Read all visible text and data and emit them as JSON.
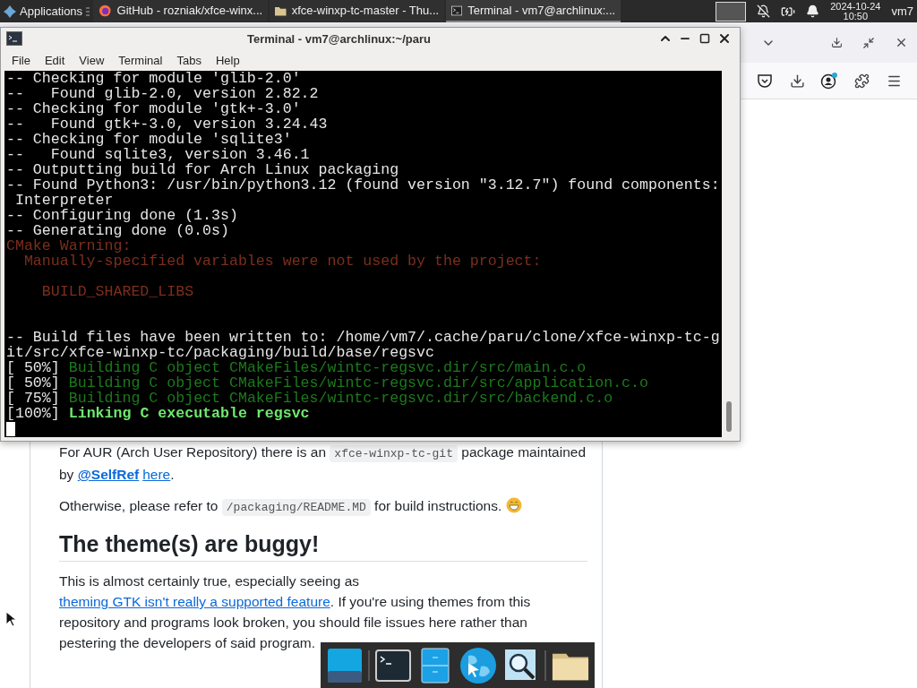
{
  "panel": {
    "menu_label": "Applications",
    "tasks": [
      {
        "title": "GitHub - rozniak/xfce-winx...",
        "kind": "browser",
        "selected": false
      },
      {
        "title": "xfce-winxp-tc-master - Thu...",
        "kind": "folder",
        "selected": false
      },
      {
        "title": "Terminal - vm7@archlinux:...",
        "kind": "terminal",
        "selected": true
      }
    ],
    "clock": {
      "date": "2024-10-24",
      "time": "10:50"
    },
    "user": "vm7"
  },
  "browser": {
    "paragraphs": [
      {
        "kind": "text",
        "parts": [
          {
            "kind": "text",
            "text": "For AUR (Arch User Repository) there is an "
          },
          {
            "kind": "code",
            "text": "xfce-winxp-tc-git"
          },
          {
            "kind": "text",
            "text": " package maintained by "
          },
          {
            "kind": "mention",
            "text": "@SelfRef"
          },
          {
            "kind": "link",
            "text": "here"
          },
          {
            "kind": "text",
            "text": "."
          }
        ]
      },
      {
        "kind": "text",
        "parts": [
          {
            "kind": "text",
            "text": "Otherwise, please refer to "
          },
          {
            "kind": "code",
            "text": "/packaging/README.MD"
          },
          {
            "kind": "text",
            "text": " for build instructions. "
          },
          {
            "kind": "emoji"
          }
        ]
      },
      {
        "kind": "heading",
        "parts": [
          {
            "kind": "text",
            "text": "The theme(s) are buggy!"
          }
        ]
      },
      {
        "kind": "text",
        "parts": [
          {
            "kind": "text",
            "text": "This is almost certainly true, especially seeing as "
          },
          {
            "kind": "link",
            "text": "theming GTK isn't really a supported feature"
          },
          {
            "kind": "text",
            "text": ". If you're using themes from this repository and programs look broken, you should file issues here rather than pestering the developers of said program."
          }
        ]
      }
    ]
  },
  "terminal": {
    "title": "Terminal - vm7@archlinux:~/paru",
    "menu": [
      "File",
      "Edit",
      "View",
      "Terminal",
      "Tabs",
      "Help"
    ],
    "lines": [
      {
        "kind": "info",
        "text": "-- Checking for module 'glib-2.0'"
      },
      {
        "kind": "info",
        "text": "--   Found glib-2.0, version 2.82.2"
      },
      {
        "kind": "info",
        "text": "-- Checking for module 'gtk+-3.0'"
      },
      {
        "kind": "info",
        "text": "--   Found gtk+-3.0, version 3.24.43"
      },
      {
        "kind": "info",
        "text": "-- Checking for module 'sqlite3'"
      },
      {
        "kind": "info",
        "text": "--   Found sqlite3, version 3.46.1"
      },
      {
        "kind": "info",
        "text": "-- Outputting build for Arch Linux packaging"
      },
      {
        "kind": "info",
        "text": "-- Found Python3: /usr/bin/python3.12 (found version \"3.12.7\") found components:"
      },
      {
        "kind": "info",
        "text": " Interpreter"
      },
      {
        "kind": "info",
        "text": "-- Configuring done (1.3s)"
      },
      {
        "kind": "info",
        "text": "-- Generating done (0.0s)"
      },
      {
        "kind": "warning",
        "text": "CMake Warning:"
      },
      {
        "kind": "warning",
        "text": "  Manually-specified variables were not used by the project:"
      },
      {
        "kind": "blank"
      },
      {
        "kind": "warning",
        "text": "    BUILD_SHARED_LIBS"
      },
      {
        "kind": "blank"
      },
      {
        "kind": "blank"
      },
      {
        "kind": "info",
        "text": "-- Build files have been written to: /home/vm7/.cache/paru/clone/xfce-winxp-tc-g"
      },
      {
        "kind": "info",
        "text": "it/src/xfce-winxp-tc/packaging/build/base/regsvc"
      },
      {
        "kind": "progress",
        "prefix": "[ 50%]",
        "text": "Building C object CMakeFiles/wintc-regsvc.dir/src/main.c.o"
      },
      {
        "kind": "progress",
        "prefix": "[ 50%]",
        "text": "Building C object CMakeFiles/wintc-regsvc.dir/src/application.c.o"
      },
      {
        "kind": "progress",
        "prefix": "[ 75%]",
        "text": "Building C object CMakeFiles/wintc-regsvc.dir/src/backend.c.o"
      },
      {
        "kind": "done",
        "prefix": "[100%]",
        "text": "Linking C executable regsvc"
      },
      {
        "kind": "cursor"
      }
    ]
  },
  "dock": [
    {
      "kind": "desktop"
    },
    {
      "kind": "separator"
    },
    {
      "kind": "terminal"
    },
    {
      "kind": "cabinet"
    },
    {
      "kind": "globe"
    },
    {
      "kind": "search"
    },
    {
      "kind": "separator"
    },
    {
      "kind": "folder"
    }
  ]
}
